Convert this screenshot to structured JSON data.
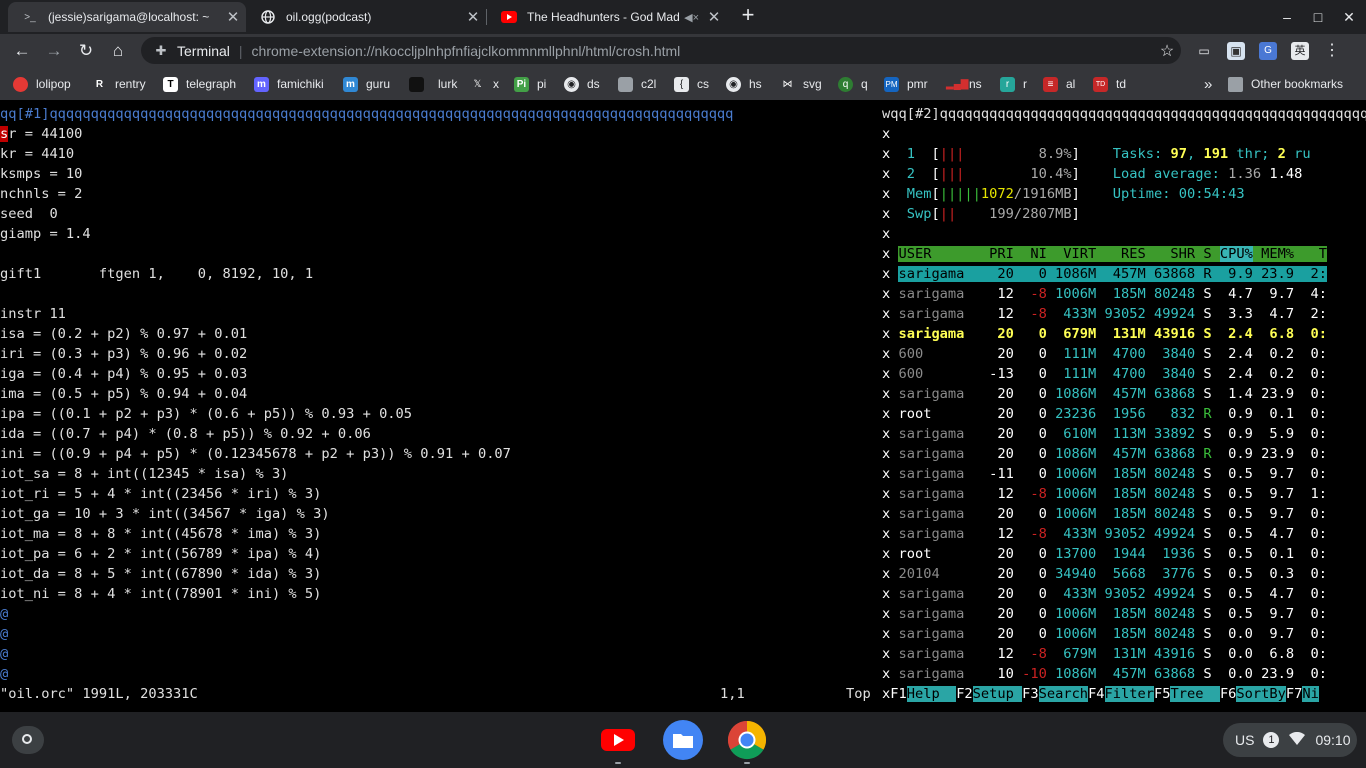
{
  "window": {
    "tabs": [
      {
        "title": "(jessie)sarigama@localhost: ~",
        "icon": "terminal-icon",
        "active": true
      },
      {
        "title": "oil.ogg(podcast)",
        "icon": "globe-icon",
        "active": false
      },
      {
        "title": "The Headhunters - God Mad",
        "icon": "youtube-icon",
        "active": false
      }
    ],
    "new_tab": "+",
    "controls": {
      "minimize": "–",
      "maximize": "□",
      "close": "✕"
    }
  },
  "toolbar": {
    "site_label": "Terminal",
    "url": "chrome-extension://nkoccljplnhpfnfiajclkommnmllphnl/html/crosh.html"
  },
  "bookmarks": {
    "items": [
      {
        "label": "lolipop",
        "icon": "lollipop-icon",
        "color": "#e53935"
      },
      {
        "label": "rentry",
        "icon": "r-icon",
        "color": "#222222"
      },
      {
        "label": "telegraph",
        "icon": "t-icon",
        "color": "#ffffff"
      },
      {
        "label": "famichiki",
        "icon": "mastodon-icon",
        "color": "#6364ff"
      },
      {
        "label": "guru",
        "icon": "mastodon-icon",
        "color": "#3088d4"
      },
      {
        "label": "lurk",
        "icon": "dark-icon",
        "color": "#222222"
      },
      {
        "label": "x",
        "icon": "x-icon",
        "color": "#000000"
      },
      {
        "label": "pi",
        "icon": "pi-icon",
        "color": "#43a047"
      },
      {
        "label": "ds",
        "icon": "globe-icon",
        "color": "#9aa0a6"
      },
      {
        "label": "c2l",
        "icon": "file-icon",
        "color": "#9aa0a6"
      },
      {
        "label": "cs",
        "icon": "cs-icon",
        "color": "#9aa0a6"
      },
      {
        "label": "hs",
        "icon": "globe-icon",
        "color": "#9aa0a6"
      },
      {
        "label": "svg",
        "icon": "svg-icon",
        "color": "#9aa0a6"
      },
      {
        "label": "q",
        "icon": "q-icon",
        "color": "#2e7d32"
      },
      {
        "label": "pmr",
        "icon": "pmr-icon",
        "color": "#1565c0"
      },
      {
        "label": "ns",
        "icon": "bar-chart-icon",
        "color": "#d32f2f"
      },
      {
        "label": "r",
        "icon": "r-icon",
        "color": "#26a69a"
      },
      {
        "label": "al",
        "icon": "al-icon",
        "color": "#c62828"
      },
      {
        "label": "td",
        "icon": "td-icon",
        "color": "#c62828"
      }
    ],
    "overflow": "»",
    "other": "Other bookmarks"
  },
  "vim": {
    "tabline": "qq[#1]qqqqqqqqqqqqqqqqqqqqqqqqqqqqqqqqqqqqqqqqqqqqqqqqqqqqqqqqqqqqqqqqqqqqqqqqqqqqqqqqqqq",
    "lines": [
      "sr = 44100",
      "kr = 4410",
      "ksmps = 10",
      "nchnls = 2",
      "seed  0",
      "giamp = 1.4",
      "",
      "gift1       ftgen 1,    0, 8192, 10, 1",
      "",
      "instr 11",
      "isa = (0.2 + p2) % 0.97 + 0.01",
      "iri = (0.3 + p3) % 0.96 + 0.02",
      "iga = (0.4 + p4) % 0.95 + 0.03",
      "ima = (0.5 + p5) % 0.94 + 0.04",
      "ipa = ((0.1 + p2 + p3) * (0.6 + p5)) % 0.93 + 0.05",
      "ida = ((0.7 + p4) * (0.8 + p5)) % 0.92 + 0.06",
      "ini = ((0.9 + p4 + p5) * (0.12345678 + p2 + p3)) % 0.91 + 0.07",
      "iot_sa = 8 + int((12345 * isa) % 3)",
      "iot_ri = 5 + 4 * int((23456 * iri) % 3)",
      "iot_ga = 10 + 3 * int((34567 * iga) % 3)",
      "iot_ma = 8 + 8 * int((45678 * ima) % 3)",
      "iot_pa = 6 + 2 * int((56789 * ipa) % 4)",
      "iot_da = 8 + 5 * int((67890 * ida) % 3)",
      "iot_ni = 8 + 4 * int((78901 * ini) % 5)"
    ],
    "tilde": "@",
    "tilde_count": 4,
    "status_file": "\"oil.orc\" 1991L, 203331C",
    "status_pos": "1,1",
    "status_scroll": "Top"
  },
  "htop": {
    "tabline": "wqq[#2]qqqqqqqqqqqqqqqqqqqqqqqqqqqqqqqqqqqqqqqqqqqqqqqqqqqqqqqqqq",
    "border": "x",
    "cpu": [
      {
        "label": "1",
        "bars": "|||",
        "percent": "8.9%"
      },
      {
        "label": "2",
        "bars": "|||",
        "percent": "10.4%"
      }
    ],
    "mem": {
      "label": "Mem",
      "bars": "|||||",
      "value": "1072",
      "total": "1916MB"
    },
    "swp": {
      "label": "Swp",
      "bars": "||",
      "value": "199/2807MB"
    },
    "tasks": {
      "label": "Tasks:",
      "count": "97",
      "threads": "191",
      "thr": "thr;",
      "running": "2",
      "run": "ru"
    },
    "load": {
      "label": "Load average:",
      "v1": "1.36",
      "v2": "1.48"
    },
    "uptime": {
      "label": "Uptime:",
      "value": "00:54:43"
    },
    "columns": {
      "user": "USER",
      "pri": "PRI",
      "ni": "NI",
      "virt": "VIRT",
      "res": "RES",
      "shr": "SHR",
      "s": "S",
      "cpu": "CPU%",
      "mem": "MEM%",
      "time": "T"
    },
    "processes": [
      {
        "user": "sarigama",
        "pri": "20",
        "ni": "0",
        "virt": "1086M",
        "res": "457M",
        "shr": "63868",
        "s": "R",
        "cpu": "9.9",
        "mem": "23.9",
        "time": "2:"
      },
      {
        "user": "sarigama",
        "pri": "12",
        "ni": "-8",
        "virt": "1006M",
        "res": "185M",
        "shr": "80248",
        "s": "S",
        "cpu": "4.7",
        "mem": "9.7",
        "time": "4:"
      },
      {
        "user": "sarigama",
        "pri": "12",
        "ni": "-8",
        "virt": "433M",
        "res": "93052",
        "shr": "49924",
        "s": "S",
        "cpu": "3.3",
        "mem": "4.7",
        "time": "2:"
      },
      {
        "user": "sarigama",
        "pri": "20",
        "ni": "0",
        "virt": "679M",
        "res": "131M",
        "shr": "43916",
        "s": "S",
        "cpu": "2.4",
        "mem": "6.8",
        "time": "0:"
      },
      {
        "user": "600",
        "pri": "20",
        "ni": "0",
        "virt": "111M",
        "res": "4700",
        "shr": "3840",
        "s": "S",
        "cpu": "2.4",
        "mem": "0.2",
        "time": "0:"
      },
      {
        "user": "600",
        "pri": "-13",
        "ni": "0",
        "virt": "111M",
        "res": "4700",
        "shr": "3840",
        "s": "S",
        "cpu": "2.4",
        "mem": "0.2",
        "time": "0:"
      },
      {
        "user": "sarigama",
        "pri": "20",
        "ni": "0",
        "virt": "1086M",
        "res": "457M",
        "shr": "63868",
        "s": "S",
        "cpu": "1.4",
        "mem": "23.9",
        "time": "0:"
      },
      {
        "user": "root",
        "pri": "20",
        "ni": "0",
        "virt": "23236",
        "res": "1956",
        "shr": "832",
        "s": "R",
        "cpu": "0.9",
        "mem": "0.1",
        "time": "0:"
      },
      {
        "user": "sarigama",
        "pri": "20",
        "ni": "0",
        "virt": "610M",
        "res": "113M",
        "shr": "33892",
        "s": "S",
        "cpu": "0.9",
        "mem": "5.9",
        "time": "0:"
      },
      {
        "user": "sarigama",
        "pri": "20",
        "ni": "0",
        "virt": "1086M",
        "res": "457M",
        "shr": "63868",
        "s": "R",
        "cpu": "0.9",
        "mem": "23.9",
        "time": "0:"
      },
      {
        "user": "sarigama",
        "pri": "-11",
        "ni": "0",
        "virt": "1006M",
        "res": "185M",
        "shr": "80248",
        "s": "S",
        "cpu": "0.5",
        "mem": "9.7",
        "time": "0:"
      },
      {
        "user": "sarigama",
        "pri": "12",
        "ni": "-8",
        "virt": "1006M",
        "res": "185M",
        "shr": "80248",
        "s": "S",
        "cpu": "0.5",
        "mem": "9.7",
        "time": "1:"
      },
      {
        "user": "sarigama",
        "pri": "20",
        "ni": "0",
        "virt": "1006M",
        "res": "185M",
        "shr": "80248",
        "s": "S",
        "cpu": "0.5",
        "mem": "9.7",
        "time": "0:"
      },
      {
        "user": "sarigama",
        "pri": "12",
        "ni": "-8",
        "virt": "433M",
        "res": "93052",
        "shr": "49924",
        "s": "S",
        "cpu": "0.5",
        "mem": "4.7",
        "time": "0:"
      },
      {
        "user": "root",
        "pri": "20",
        "ni": "0",
        "virt": "13700",
        "res": "1944",
        "shr": "1936",
        "s": "S",
        "cpu": "0.5",
        "mem": "0.1",
        "time": "0:"
      },
      {
        "user": "20104",
        "pri": "20",
        "ni": "0",
        "virt": "34940",
        "res": "5668",
        "shr": "3776",
        "s": "S",
        "cpu": "0.5",
        "mem": "0.3",
        "time": "0:"
      },
      {
        "user": "sarigama",
        "pri": "20",
        "ni": "0",
        "virt": "433M",
        "res": "93052",
        "shr": "49924",
        "s": "S",
        "cpu": "0.5",
        "mem": "4.7",
        "time": "0:"
      },
      {
        "user": "sarigama",
        "pri": "20",
        "ni": "0",
        "virt": "1006M",
        "res": "185M",
        "shr": "80248",
        "s": "S",
        "cpu": "0.5",
        "mem": "9.7",
        "time": "0:"
      },
      {
        "user": "sarigama",
        "pri": "20",
        "ni": "0",
        "virt": "1006M",
        "res": "185M",
        "shr": "80248",
        "s": "S",
        "cpu": "0.0",
        "mem": "9.7",
        "time": "0:"
      },
      {
        "user": "sarigama",
        "pri": "12",
        "ni": "-8",
        "virt": "679M",
        "res": "131M",
        "shr": "43916",
        "s": "S",
        "cpu": "0.0",
        "mem": "6.8",
        "time": "0:"
      },
      {
        "user": "sarigama",
        "pri": "10",
        "ni": "-10",
        "virt": "1086M",
        "res": "457M",
        "shr": "63868",
        "s": "S",
        "cpu": "0.0",
        "mem": "23.9",
        "time": "0:"
      }
    ],
    "fkeys": [
      {
        "key": "F1",
        "label": "Help  "
      },
      {
        "key": "F2",
        "label": "Setup "
      },
      {
        "key": "F3",
        "label": "Search"
      },
      {
        "key": "F4",
        "label": "Filter"
      },
      {
        "key": "F5",
        "label": "Tree  "
      },
      {
        "key": "F6",
        "label": "SortBy"
      },
      {
        "key": "F7",
        "label": "Ni"
      }
    ]
  },
  "shelf": {
    "apps": [
      {
        "name": "YouTube",
        "icon": "youtube-icon"
      },
      {
        "name": "Files",
        "icon": "folder-icon"
      },
      {
        "name": "Chrome",
        "icon": "chrome-icon"
      }
    ],
    "tray": {
      "locale": "US",
      "notifications": "1",
      "time": "09:10"
    }
  }
}
